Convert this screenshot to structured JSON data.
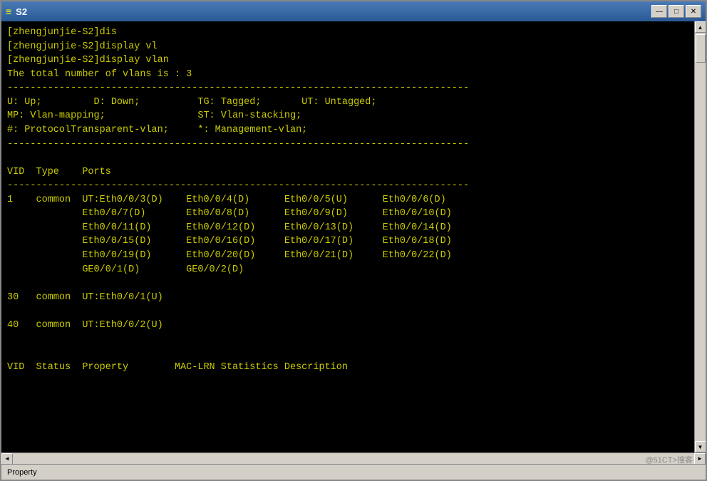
{
  "window": {
    "title": "S2",
    "icon": "S",
    "buttons": {
      "minimize": "—",
      "maximize": "□",
      "close": "✕"
    }
  },
  "terminal": {
    "lines": [
      "[zhengjunjie-S2]dis",
      "[zhengjunjie-S2]display vl",
      "[zhengjunjie-S2]display vlan",
      "The total number of vlans is : 3",
      "--------------------------------------------------------------------------------",
      "U: Up;         D: Down;          TG: Tagged;       UT: Untagged;",
      "MP: Vlan-mapping;                ST: Vlan-stacking;",
      "#: ProtocolTransparent-vlan;     *: Management-vlan;",
      "--------------------------------------------------------------------------------",
      "",
      "VID  Type    Ports",
      "--------------------------------------------------------------------------------",
      "1    common  UT:Eth0/0/3(D)    Eth0/0/4(D)      Eth0/0/5(U)      Eth0/0/6(D)",
      "             Eth0/0/7(D)       Eth0/0/8(D)      Eth0/0/9(D)      Eth0/0/10(D)",
      "             Eth0/0/11(D)      Eth0/0/12(D)     Eth0/0/13(D)     Eth0/0/14(D)",
      "             Eth0/0/15(D)      Eth0/0/16(D)     Eth0/0/17(D)     Eth0/0/18(D)",
      "             Eth0/0/19(D)      Eth0/0/20(D)     Eth0/0/21(D)     Eth0/0/22(D)",
      "             GE0/0/1(D)        GE0/0/2(D)",
      "",
      "30   common  UT:Eth0/0/1(U)",
      "",
      "40   common  UT:Eth0/0/2(U)",
      "",
      "",
      "VID  Status  Property        MAC-LRN Statistics Description"
    ]
  },
  "statusbar": {
    "property_label": "Property"
  },
  "watermark": "@51CT>搜客"
}
